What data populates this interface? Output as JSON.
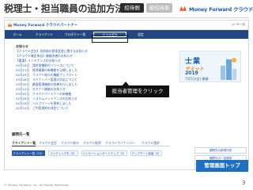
{
  "slide": {
    "title": "税理士・担当職員の追加方法",
    "pills": {
      "active": "招待側",
      "inactive": "被招待側"
    },
    "brand": "Money Forward クラウド",
    "caption": "管理画面トップ",
    "page_number": "3",
    "copyright": "© Money Forward, Inc. All Rights Reserved."
  },
  "app": {
    "logo": "Money Forward クラウドパートナー",
    "user": "ユーザー名",
    "nav": [
      "ホーム",
      "クライアント",
      "プロダクト一覧",
      "担当者管理",
      "設定"
    ],
    "notice_title": "お知らせ",
    "notices": [
      "【クラウド会計】消費税の税率変更に関するお知らせ",
      "【クラウド確定申告】機能改善のお知らせ",
      "【重要】メンテナンスのお知らせ",
      "04月18日　請求書機能のリリースについて",
      "04月11日　経費精算の新機能を公開しました",
      "04月05日　クラウド給与の機能アップデート",
      "03月28日　マイナンバー管理の対応について",
      "03月20日　顧客管理機能の改善を行いました",
      "03月12日　セミナー開催のお知らせ",
      "03月05日　クラウドパートナーの新機能",
      "02月26日　システムメンテナンスのお知らせ",
      "02月18日　ヘルプページを更新しました",
      "02月10日　ご利用規約の改定について"
    ],
    "banner": {
      "kanji": "士業",
      "summit": "サミット",
      "year": "2019",
      "date": "7月5日(金) 開催"
    },
    "tooltip": "担当者管理をクリック",
    "client_section_title": "顧問先一覧",
    "client_tabs": [
      "クライアント一覧",
      "クラウド会計",
      "クラウド給与",
      "クラウド経費",
      "クラウドマイナンバー",
      "クラウド請求"
    ],
    "filter_chips": [
      "クライアント一覧（10）",
      "ペンディング中（0）",
      "バンケーションガードアップ（0）",
      "アップデート保留（0）"
    ],
    "right_buttons": [
      "顧問先の新規作成",
      "顧問先の一括登録",
      "顧問先を追加する"
    ]
  },
  "colors": {
    "brand_blue": "#1f5ca8",
    "nav_bg": "#22467f",
    "caption_bg": "#1f6fc0",
    "tooltip_bg": "#111111"
  }
}
